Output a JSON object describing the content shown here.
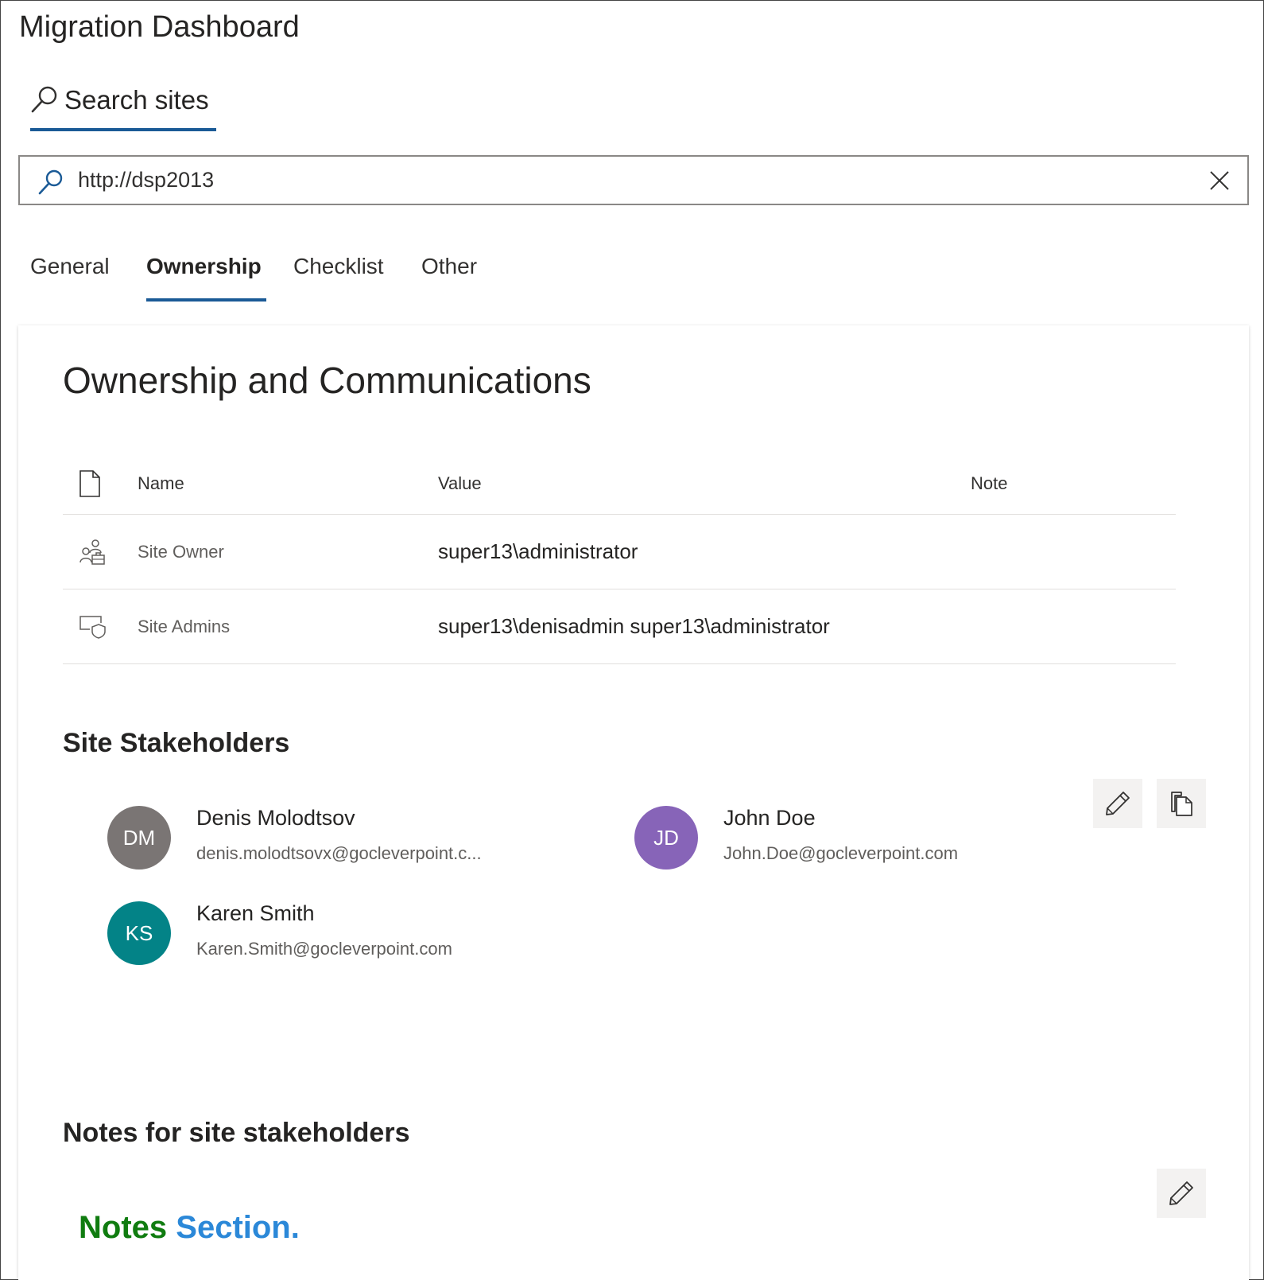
{
  "app": {
    "title": "Migration Dashboard"
  },
  "search": {
    "tab_label": "Search sites",
    "value": "http://dsp2013"
  },
  "tabs": [
    {
      "label": "General",
      "active": false
    },
    {
      "label": "Ownership",
      "active": true
    },
    {
      "label": "Checklist",
      "active": false
    },
    {
      "label": "Other",
      "active": false
    }
  ],
  "ownership": {
    "title": "Ownership and Communications",
    "table": {
      "columns": [
        "Name",
        "Value",
        "Note"
      ],
      "rows": [
        {
          "icon": "people-briefcase-icon",
          "name": "Site Owner",
          "value": "super13\\administrator",
          "note": ""
        },
        {
          "icon": "shield-screen-icon",
          "name": "Site Admins",
          "value": "super13\\denisadmin super13\\administrator",
          "note": ""
        }
      ]
    }
  },
  "stakeholders": {
    "heading": "Site Stakeholders",
    "people": [
      {
        "initials": "DM",
        "name": "Denis Molodtsov",
        "email": "denis.molodtsovx@gocleverpoint.c...",
        "color": "#7a7574"
      },
      {
        "initials": "JD",
        "name": "John Doe",
        "email": "John.Doe@gocleverpoint.com",
        "color": "#8764b8"
      },
      {
        "initials": "KS",
        "name": "Karen Smith",
        "email": "Karen.Smith@gocleverpoint.com",
        "color": "#038387"
      }
    ]
  },
  "notes": {
    "heading": "Notes for site stakeholders",
    "text_word1": "Notes",
    "text_word2": "Section.",
    "word1_color": "#107c10",
    "word2_color": "#2b88d8"
  },
  "colors": {
    "accent": "#1a5a96"
  }
}
